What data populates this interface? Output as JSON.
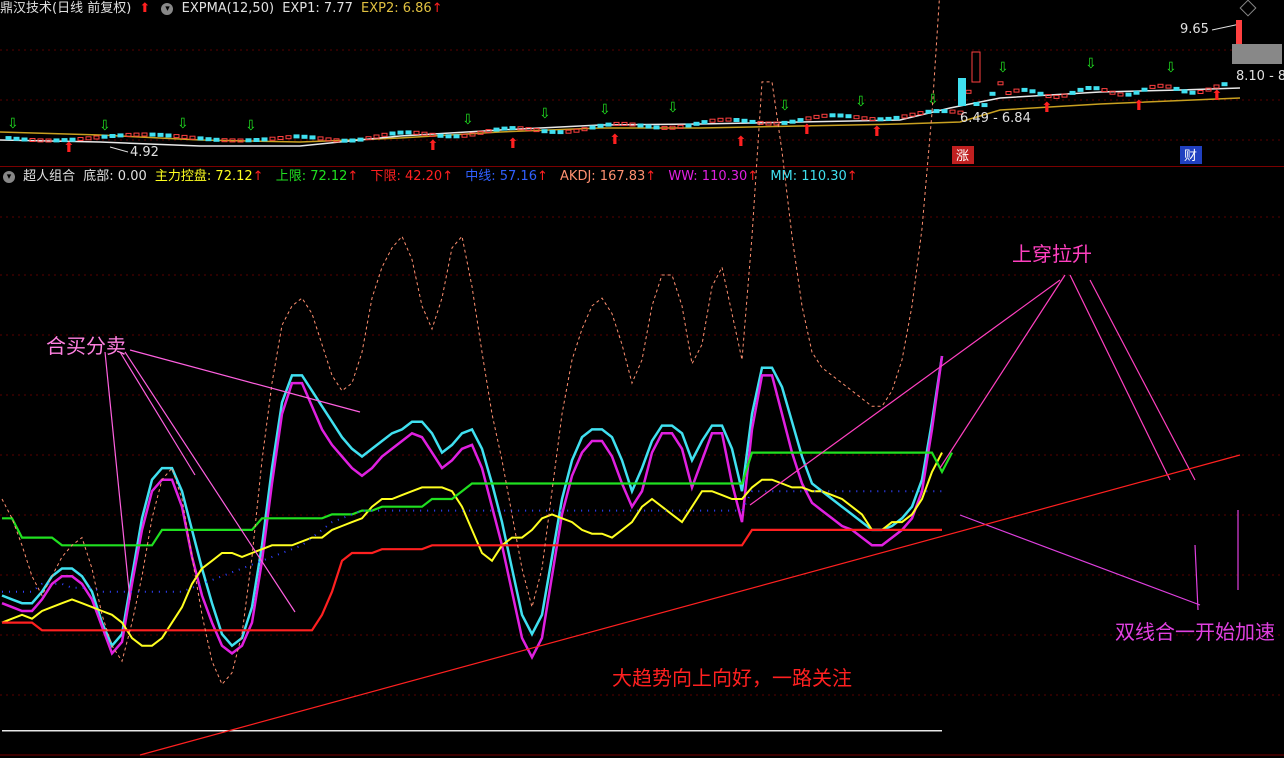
{
  "top_header": {
    "title": "鼎汉技术(日线 前复权)",
    "indicator": "EXPMA(12,50)",
    "exp1_label": "EXP1: 7.77",
    "exp2_label": "EXP2: 6.86",
    "up_arrow": "↑"
  },
  "price_labels": {
    "high": "9.65",
    "low": "4.92",
    "range1": "6.49 - 6.84",
    "range2": "8.10 - 8",
    "badge_zhang": "涨",
    "badge_cai": "财"
  },
  "bottom_header": {
    "title": "超人组合",
    "bottom": "底部: 0.00",
    "main_ctrl": "主力控盘: 72.12",
    "upper": "上限: 72.12",
    "lower": "下限: 42.20",
    "middle": "中线: 57.16",
    "akdj": "AKDJ: 167.83",
    "ww": "WW: 110.30",
    "mm": "MM: 110.30",
    "up_arrow": "↑"
  },
  "annotations": {
    "buy_sell": "合买分卖",
    "cross_up": "上穿拉升",
    "merge_accel": "双线合一开始加速",
    "trend": "大趋势向上向好，一路关注"
  },
  "colors": {
    "cyan": "#40e0f0",
    "magenta": "#e020e0",
    "yellow": "#ffff20",
    "green": "#20e020",
    "red": "#ff2020",
    "white": "#e8e8e8",
    "pink_dash": "#ff9070",
    "annot_pink": "#ff60c0",
    "annot_red": "#ff2020"
  },
  "chart_data": {
    "type": "line",
    "x": [
      0,
      10,
      20,
      30,
      40,
      50,
      60,
      70,
      80,
      90,
      100,
      110,
      120,
      130,
      140,
      150,
      160,
      170,
      180,
      190,
      200,
      210,
      220,
      230,
      240,
      250,
      260,
      270,
      280,
      290,
      300,
      310,
      320,
      330,
      340,
      350,
      360,
      370,
      380,
      390,
      400,
      410,
      420,
      430,
      440,
      450,
      460,
      470,
      480,
      490,
      500,
      510,
      520,
      530,
      540,
      550,
      560,
      570,
      580,
      590,
      600,
      610,
      620,
      630,
      640,
      650,
      660,
      670,
      680,
      690,
      700,
      710,
      720,
      730,
      740,
      750,
      760,
      770,
      780,
      790,
      800,
      810,
      820,
      830,
      840,
      850,
      860,
      870,
      880,
      890,
      900,
      910,
      920,
      930,
      940,
      950,
      960,
      970,
      980,
      990,
      1000,
      1010,
      1020,
      1030,
      1040,
      1050,
      1060,
      1070,
      1080,
      1090,
      1100,
      1110,
      1120,
      1130,
      1140,
      1150,
      1160,
      1170,
      1180,
      1190,
      1200,
      1210,
      1220,
      1230,
      1240
    ],
    "series": [
      {
        "name": "MM",
        "values": [
          35,
          34,
          33,
          33,
          36,
          40,
          42,
          42,
          40,
          36,
          28,
          22,
          25,
          40,
          55,
          65,
          68,
          68,
          62,
          52,
          42,
          33,
          25,
          22,
          24,
          32,
          48,
          68,
          85,
          92,
          92,
          88,
          84,
          80,
          76,
          73,
          71,
          73,
          75,
          77,
          78,
          80,
          80,
          77,
          72,
          74,
          77,
          78,
          73,
          64,
          54,
          42,
          30,
          25,
          30,
          45,
          60,
          70,
          76,
          78,
          78,
          76,
          70,
          62,
          68,
          75,
          79,
          79,
          77,
          70,
          75,
          79,
          79,
          73,
          62,
          82,
          94,
          94,
          89,
          80,
          71,
          64,
          62,
          60,
          58,
          56,
          54,
          52,
          52,
          53,
          55,
          58,
          65,
          80,
          97
        ]
      },
      {
        "name": "WW",
        "values": [
          33,
          32,
          31,
          31,
          34,
          38,
          40,
          40,
          38,
          34,
          27,
          20,
          23,
          38,
          52,
          62,
          65,
          65,
          58,
          45,
          35,
          28,
          22,
          20,
          22,
          28,
          44,
          64,
          82,
          90,
          90,
          84,
          78,
          74,
          71,
          68,
          66,
          68,
          71,
          73,
          75,
          77,
          76,
          72,
          68,
          70,
          73,
          74,
          68,
          58,
          48,
          36,
          24,
          19,
          24,
          40,
          56,
          66,
          72,
          75,
          75,
          71,
          64,
          58,
          62,
          72,
          77,
          77,
          73,
          63,
          70,
          77,
          77,
          64,
          54,
          78,
          92,
          92,
          82,
          72,
          64,
          59,
          57,
          55,
          53,
          52,
          50,
          48,
          48,
          50,
          52,
          55,
          62,
          78,
          97
        ]
      },
      {
        "name": "主力控盘",
        "values": [
          28,
          29,
          30,
          29,
          31,
          32,
          33,
          34,
          33,
          32,
          31,
          30,
          28,
          24,
          22,
          22,
          24,
          28,
          32,
          38,
          42,
          44,
          46,
          46,
          45,
          46,
          47,
          48,
          48,
          48,
          49,
          50,
          50,
          52,
          53,
          54,
          55,
          58,
          60,
          60,
          61,
          62,
          63,
          63,
          63,
          62,
          58,
          52,
          46,
          44,
          48,
          50,
          50,
          52,
          55,
          56,
          55,
          54,
          52,
          51,
          51,
          50,
          52,
          54,
          58,
          60,
          58,
          56,
          54,
          58,
          62,
          62,
          61,
          60,
          60,
          63,
          65,
          65,
          64,
          63,
          63,
          62,
          62,
          61,
          60,
          58,
          56,
          52,
          52,
          54,
          54,
          56,
          60,
          67,
          72
        ]
      },
      {
        "name": "上限",
        "values": [
          55,
          55,
          50,
          50,
          50,
          50,
          48,
          48,
          48,
          48,
          48,
          48,
          48,
          48,
          48,
          48,
          52,
          52,
          52,
          52,
          52,
          52,
          52,
          52,
          52,
          52,
          55,
          55,
          55,
          55,
          55,
          55,
          55,
          56,
          56,
          56,
          57,
          57,
          58,
          58,
          58,
          58,
          58,
          60,
          60,
          60,
          62,
          64,
          64,
          64,
          64,
          64,
          64,
          64,
          64,
          64,
          64,
          64,
          64,
          64,
          64,
          64,
          64,
          64,
          64,
          64,
          64,
          64,
          64,
          64,
          64,
          64,
          64,
          64,
          64,
          72,
          72,
          72,
          72,
          72,
          72,
          72,
          72,
          72,
          72,
          72,
          72,
          72,
          72,
          72,
          72,
          72,
          72,
          72,
          67,
          72
        ]
      },
      {
        "name": "下限",
        "values": [
          28,
          28,
          28,
          28,
          26,
          26,
          26,
          26,
          26,
          26,
          26,
          26,
          26,
          26,
          26,
          26,
          26,
          26,
          26,
          26,
          26,
          26,
          26,
          26,
          26,
          26,
          26,
          26,
          26,
          26,
          26,
          26,
          30,
          36,
          44,
          46,
          46,
          46,
          47,
          47,
          47,
          47,
          47,
          48,
          48,
          48,
          48,
          48,
          48,
          48,
          48,
          48,
          48,
          48,
          48,
          48,
          48,
          48,
          48,
          48,
          48,
          48,
          48,
          48,
          48,
          48,
          48,
          48,
          48,
          48,
          48,
          48,
          48,
          48,
          48,
          52,
          52,
          52,
          52,
          52,
          52,
          52,
          52,
          52,
          52,
          52,
          52,
          52,
          52,
          52,
          52,
          52,
          52,
          52,
          52
        ]
      },
      {
        "name": "底部",
        "values": [
          0,
          0,
          0,
          0,
          0,
          0,
          0,
          0,
          0,
          0,
          0,
          0,
          0,
          0,
          0,
          0,
          0,
          0,
          0,
          0,
          0,
          0,
          0,
          0,
          0,
          0,
          0,
          0,
          0,
          0,
          0,
          0,
          0,
          0,
          0,
          0,
          0,
          0,
          0,
          0,
          0,
          0,
          0,
          0,
          0,
          0,
          0,
          0,
          0,
          0,
          0,
          0,
          0,
          0,
          0,
          0,
          0,
          0,
          0,
          0,
          0,
          0,
          0,
          0,
          0,
          0,
          0,
          0,
          0,
          0,
          0,
          0,
          0,
          0,
          0,
          0,
          0,
          0,
          0,
          0,
          0,
          0,
          0,
          0,
          0,
          0,
          0,
          0,
          0,
          0,
          0,
          0,
          0,
          0,
          0
        ]
      },
      {
        "name": "AKDJ",
        "values": [
          60,
          55,
          48,
          40,
          35,
          40,
          45,
          48,
          50,
          42,
          30,
          22,
          18,
          28,
          40,
          55,
          65,
          68,
          60,
          45,
          30,
          18,
          12,
          15,
          25,
          45,
          70,
          90,
          105,
          110,
          112,
          108,
          100,
          92,
          88,
          90,
          98,
          112,
          120,
          125,
          128,
          122,
          110,
          104,
          112,
          125,
          128,
          115,
          98,
          82,
          70,
          56,
          42,
          32,
          42,
          62,
          82,
          96,
          104,
          110,
          112,
          108,
          100,
          90,
          96,
          110,
          118,
          118,
          110,
          95,
          100,
          115,
          120,
          108,
          96,
          128,
          168,
          168,
          150,
          128,
          110,
          98,
          94,
          92,
          90,
          88,
          86,
          84,
          84,
          88,
          96,
          110,
          130,
          160,
          200
        ]
      }
    ],
    "ylim": [
      -5,
      140
    ]
  }
}
